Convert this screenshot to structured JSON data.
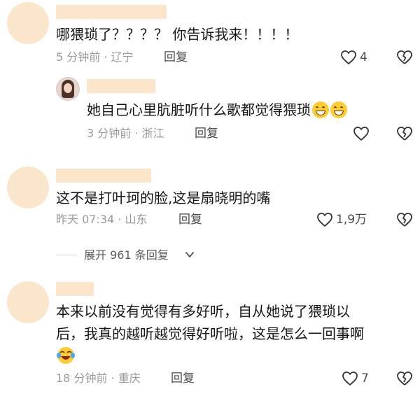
{
  "comments": [
    {
      "text": "哪猥琐了？？？？ 你告诉我来！！！！",
      "meta": "5 分钟前 · 辽宁",
      "reply": "回复",
      "likes": "4",
      "replies": [
        {
          "text": "她自己心里肮脏听什么歌都觉得猥琐",
          "meta": "3 分钟前 · 浙江",
          "reply": "回复"
        }
      ]
    },
    {
      "text": "这不是打叶珂的脸,这是扇晓明的嘴",
      "meta": "昨天 07:34 · 山东",
      "reply": "回复",
      "likes": "1,9万",
      "expand": "展开 961 条回复"
    },
    {
      "text_line1": "本来以前没有觉得有多好听，自从她说了猥琐以",
      "text_line2": "后，我真的越听越觉得好听啦，这是怎么一回事啊",
      "meta": "18 分钟前 · 重庆",
      "reply": "回复",
      "likes": "7"
    }
  ],
  "icons": {
    "like": "heart-outline-icon",
    "dislike": "broken-heart-icon",
    "expand": "chevron-down-icon",
    "grin_emoji": "grinning-face-emoji",
    "laugh_emoji": "laughing-tears-emoji"
  },
  "colors": {
    "placeholder": "#fbe6cc",
    "meta_text": "#9a9a9a",
    "body_text": "#161616"
  }
}
